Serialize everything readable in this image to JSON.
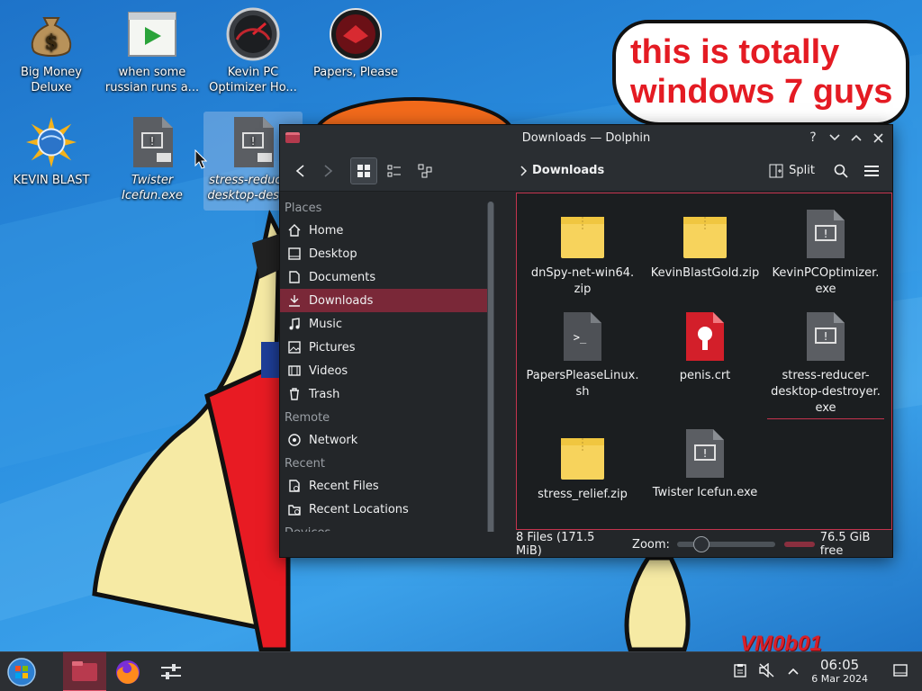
{
  "desktop": {
    "icons": [
      {
        "label": "Big Money Deluxe"
      },
      {
        "label": "when some russian runs a..."
      },
      {
        "label": "Kevin PC Optimizer Ho..."
      },
      {
        "label": "Papers, Please"
      },
      {
        "label": "KEVIN BLAST"
      },
      {
        "label": "Twister Icefun.exe"
      },
      {
        "label": "stress-reducer-desktop-destr..."
      }
    ],
    "bubble_line1": "this is totally",
    "bubble_line2": "windows 7 guys",
    "signature": "VM0b01"
  },
  "window": {
    "title": "Downloads — Dolphin",
    "toolbar": {
      "breadcrumb": "Downloads",
      "split_label": "Split"
    },
    "sidebar": {
      "places_header": "Places",
      "places": [
        {
          "label": "Home",
          "icon": "home-icon"
        },
        {
          "label": "Desktop",
          "icon": "desktop-icon"
        },
        {
          "label": "Documents",
          "icon": "documents-icon"
        },
        {
          "label": "Downloads",
          "icon": "downloads-icon"
        },
        {
          "label": "Music",
          "icon": "music-icon"
        },
        {
          "label": "Pictures",
          "icon": "pictures-icon"
        },
        {
          "label": "Videos",
          "icon": "videos-icon"
        },
        {
          "label": "Trash",
          "icon": "trash-icon"
        }
      ],
      "remote_header": "Remote",
      "remote": [
        {
          "label": "Network",
          "icon": "network-icon"
        }
      ],
      "recent_header": "Recent",
      "recent": [
        {
          "label": "Recent Files",
          "icon": "recent-files-icon"
        },
        {
          "label": "Recent Locations",
          "icon": "recent-locations-icon"
        }
      ],
      "devices_header": "Devices"
    },
    "files": [
      {
        "line1": "dnSpy-net-win64.",
        "line2": "zip",
        "type": "zip"
      },
      {
        "line1": "KevinBlastGold.zip",
        "line2": "",
        "type": "zip"
      },
      {
        "line1": "KevinPCOptimizer.",
        "line2": "exe",
        "type": "exe"
      },
      {
        "line1": "PapersPleaseLinux.",
        "line2": "sh",
        "type": "sh"
      },
      {
        "line1": "penis.crt",
        "line2": "",
        "type": "crt"
      },
      {
        "line1": "stress-reducer-",
        "line2": "desktop-destroyer.",
        "line3": "exe",
        "type": "exe"
      },
      {
        "line1": "stress_relief.zip",
        "line2": "",
        "type": "zip"
      },
      {
        "line1": "Twister Icefun.exe",
        "line2": "",
        "type": "exe"
      }
    ],
    "status": {
      "file_count": "8 Files (171.5 MiB)",
      "zoom_label": "Zoom:",
      "free_space": "76.5 GiB free"
    }
  },
  "taskbar": {
    "time": "06:05",
    "date": "6 Mar 2024"
  },
  "colors": {
    "accent": "#c5344e",
    "selection": "#7a2838",
    "window_bg": "#232629"
  }
}
